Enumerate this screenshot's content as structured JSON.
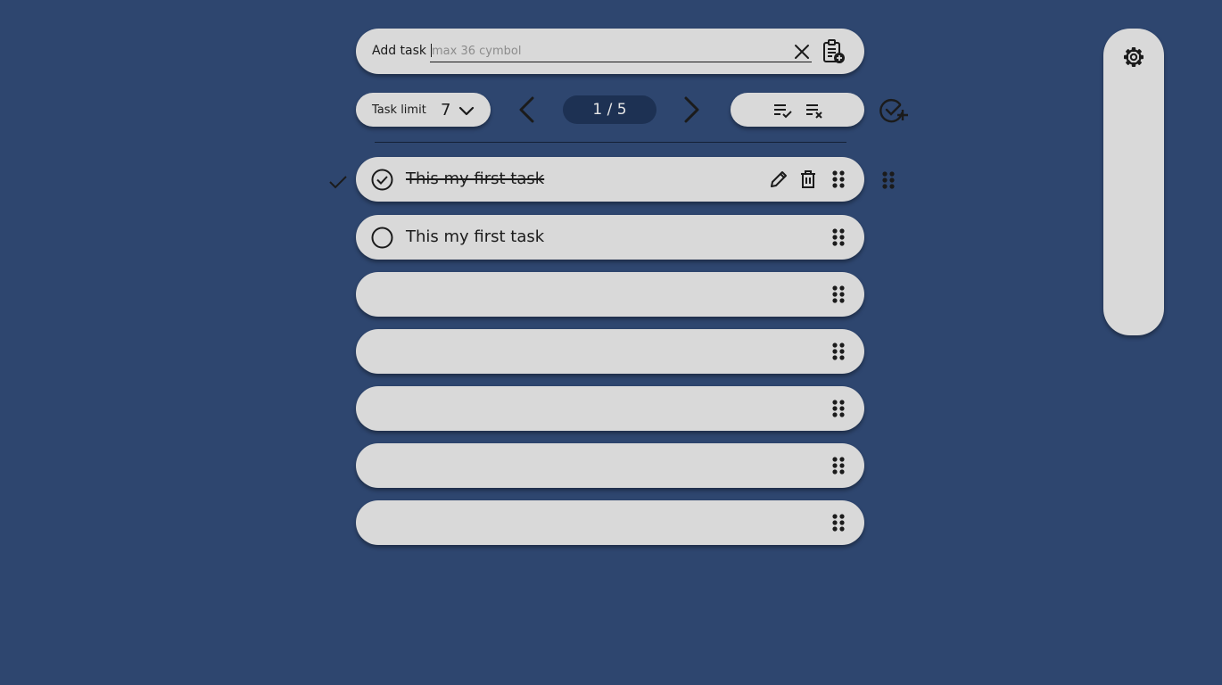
{
  "add_task": {
    "label": "Add task",
    "input_value": "",
    "placeholder": "max 36 cymbol"
  },
  "controls": {
    "task_limit_label": "Task limit",
    "task_limit_value": "7",
    "page_indicator": "1 / 5"
  },
  "tasks": [
    {
      "text": "This my first task",
      "completed": true
    },
    {
      "text": "This my first task",
      "completed": false
    },
    {
      "text": "",
      "completed": false
    },
    {
      "text": "",
      "completed": false
    },
    {
      "text": "",
      "completed": false
    },
    {
      "text": "",
      "completed": false
    },
    {
      "text": "",
      "completed": false
    }
  ],
  "icons": {
    "clear": "close-icon",
    "paste": "clipboard-add-icon",
    "limit_dropdown": "chevron-down-icon",
    "prev": "chevron-left-icon",
    "next": "chevron-right-icon",
    "check_all": "playlist-check-icon",
    "clear_all": "playlist-remove-icon",
    "add_check": "check-circle-add-icon",
    "edit": "pencil-icon",
    "delete": "trash-icon",
    "drag": "drag-handle-icon",
    "settings": "gear-icon"
  },
  "colors": {
    "background": "#2e466f",
    "pill": "#d9d9d9",
    "page_indicator_bg": "#1d3153",
    "text": "#1b1b1b"
  }
}
